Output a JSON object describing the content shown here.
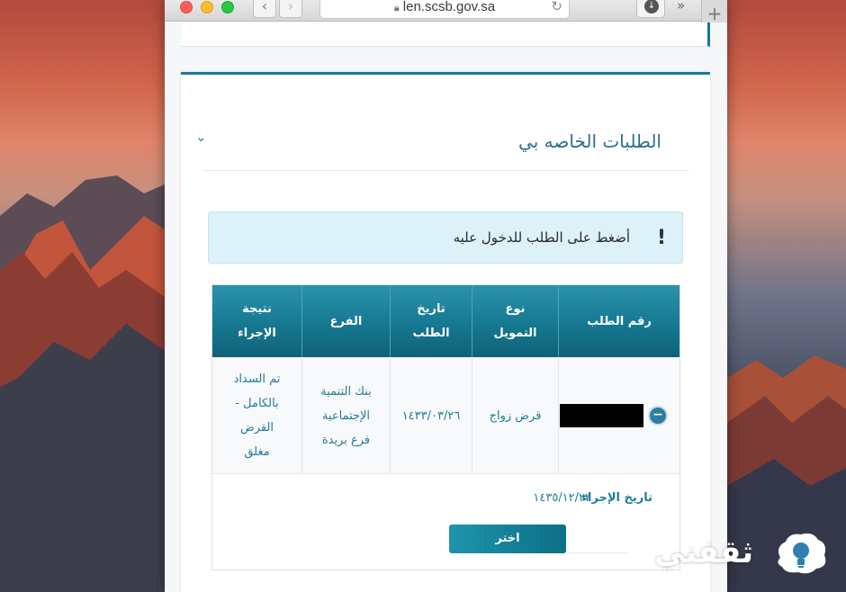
{
  "browser": {
    "url": "len.scsb.gov.sa",
    "icons": {
      "back": "chevron-left-icon",
      "forward": "chevron-right-icon",
      "lock": "lock-icon",
      "reload": "reload-icon",
      "download": "download-icon",
      "more": "chevron-double-right-icon",
      "new_tab": "plus-icon"
    }
  },
  "card": {
    "title": "الطلبات الخاصه بي",
    "collapse_icon": "chevron-down-icon"
  },
  "notice": {
    "icon": "exclamation-icon",
    "text": "أضغط على الطلب للدخول عليه"
  },
  "table": {
    "headers": [
      "رقم الطلب",
      "نوع\nالتمويل",
      "تاريخ\nالطلب",
      "الفرع",
      "نتيجة\nالإجراء"
    ],
    "row": {
      "loan_type": "قرض زواج",
      "request_date": "١٤٣٣/٠٣/٢٦",
      "branch": "بنك التنمية\nالإجتماعية\nفرع بريدة",
      "result": "تم السداد\nبالكامل -\nالقرض\nمغلق"
    },
    "detail": {
      "label": "تاريخ الإجراء",
      "value": "١٤٣٥/١٢/٢٢"
    },
    "choose_label": "اختر"
  },
  "watermark": {
    "text": "ثقفني",
    "icon": "lightbulb-icon"
  },
  "colors": {
    "accent": "#167b93",
    "header_start": "#2c93ad",
    "header_end": "#0f6178",
    "notice_bg": "#dcf1f8",
    "text_accent": "#1f7c97"
  }
}
